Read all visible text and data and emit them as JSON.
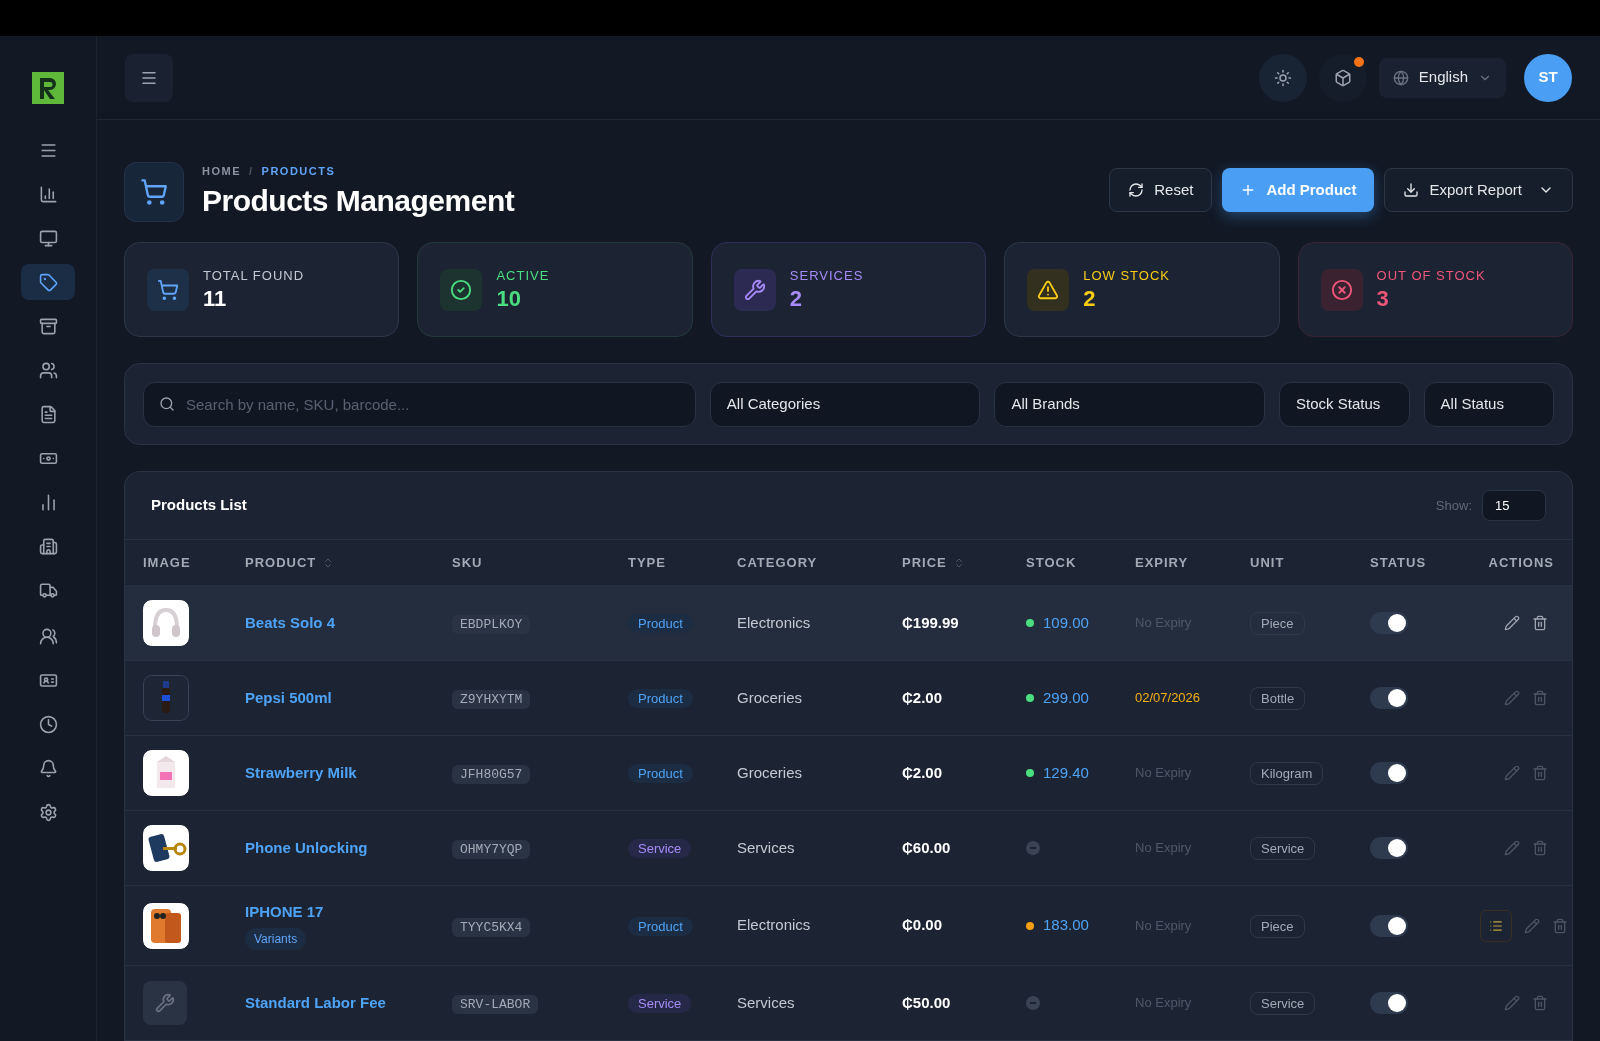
{
  "sidebar": {
    "items": [
      {
        "selected": false
      },
      {
        "selected": false
      },
      {
        "selected": false
      },
      {
        "selected": true
      },
      {
        "selected": false
      },
      {
        "selected": false
      },
      {
        "selected": false
      },
      {
        "selected": false
      },
      {
        "selected": false
      },
      {
        "selected": false
      },
      {
        "selected": false
      },
      {
        "selected": false
      },
      {
        "selected": false
      },
      {
        "selected": false
      },
      {
        "selected": false
      },
      {
        "selected": false
      }
    ]
  },
  "topbar": {
    "language": "English",
    "avatar": "ST",
    "notification": true
  },
  "breadcrumb": {
    "separator": "/",
    "items": [
      {
        "label": "HOME",
        "selected": false
      },
      {
        "label": "PRODUCTS",
        "selected": true
      }
    ]
  },
  "title": "Products Management",
  "actions": [
    {
      "kind": "reset",
      "label": "Reset"
    },
    {
      "kind": "add",
      "label": "Add Product"
    },
    {
      "kind": "export",
      "label": "Export Report"
    }
  ],
  "stats": [
    {
      "kind": "total",
      "label": "TOTAL FOUND",
      "value": "11",
      "color": "#ffffff"
    },
    {
      "kind": "active",
      "label": "ACTIVE",
      "value": "10",
      "color": "#4ade80"
    },
    {
      "kind": "services",
      "label": "SERVICES",
      "value": "2",
      "color": "#a78bfa"
    },
    {
      "kind": "low",
      "label": "LOW STOCK",
      "value": "2",
      "color": "#facc15"
    },
    {
      "kind": "out",
      "label": "OUT OF STOCK",
      "value": "3",
      "color": "#f0557a"
    }
  ],
  "filters": {
    "search_placeholder": "Search by name, SKU, barcode...",
    "selects": [
      "All Categories",
      "All Brands",
      "Stock Status",
      "All Status"
    ]
  },
  "table": {
    "title": "Products List",
    "show_label": "Show:",
    "show_value": "15",
    "columns": [
      {
        "label": "IMAGE",
        "kind": "plain"
      },
      {
        "label": "PRODUCT",
        "kind": "sortable"
      },
      {
        "label": "SKU",
        "kind": "plain"
      },
      {
        "label": "TYPE",
        "kind": "plain"
      },
      {
        "label": "CATEGORY",
        "kind": "plain"
      },
      {
        "label": "PRICE",
        "kind": "sortable"
      },
      {
        "label": "STOCK",
        "kind": "plain"
      },
      {
        "label": "EXPIRY",
        "kind": "plain"
      },
      {
        "label": "UNIT",
        "kind": "plain"
      },
      {
        "label": "STATUS",
        "kind": "plain"
      },
      {
        "label": "ACTIONS",
        "kind": "plain"
      }
    ],
    "rows": [
      {
        "selected": true,
        "name": "Beats Solo 4",
        "sku": "EBDPLKOY",
        "type": {
          "kind": "product",
          "label": "Product"
        },
        "category": "Electronics",
        "price": "₵199.99",
        "stock": {
          "kind": "tracked",
          "value": "109.00",
          "color": "#4ade80"
        },
        "expiry": {
          "kind": "none",
          "text": "No Expiry"
        },
        "unit": "Piece",
        "on": true,
        "variants_action": false
      },
      {
        "selected": false,
        "name": "Pepsi 500ml",
        "sku": "Z9YHXYTM",
        "type": {
          "kind": "product",
          "label": "Product"
        },
        "category": "Groceries",
        "price": "₵2.00",
        "stock": {
          "kind": "tracked",
          "value": "299.00",
          "color": "#4ade80"
        },
        "expiry": {
          "kind": "date",
          "text": "02/07/2026"
        },
        "unit": "Bottle",
        "on": true,
        "variants_action": false
      },
      {
        "selected": false,
        "name": "Strawberry Milk",
        "sku": "JFH80G57",
        "type": {
          "kind": "product",
          "label": "Product"
        },
        "category": "Groceries",
        "price": "₵2.00",
        "stock": {
          "kind": "tracked",
          "value": "129.40",
          "color": "#4ade80"
        },
        "expiry": {
          "kind": "none",
          "text": "No Expiry"
        },
        "unit": "Kilogram",
        "on": true,
        "variants_action": false
      },
      {
        "selected": false,
        "name": "Phone Unlocking",
        "sku": "OHMY7YQP",
        "type": {
          "kind": "service",
          "label": "Service"
        },
        "category": "Services",
        "price": "₵60.00",
        "stock": {
          "kind": "untracked"
        },
        "expiry": {
          "kind": "none",
          "text": "No Expiry"
        },
        "unit": "Service",
        "on": true,
        "variants_action": false
      },
      {
        "selected": false,
        "name": "IPHONE 17",
        "variants": "Variants",
        "sku": "TYYC5KX4",
        "type": {
          "kind": "product",
          "label": "Product"
        },
        "category": "Electronics",
        "price": "₵0.00",
        "stock": {
          "kind": "tracked",
          "value": "183.00",
          "color": "#f59e0b"
        },
        "expiry": {
          "kind": "none",
          "text": "No Expiry"
        },
        "unit": "Piece",
        "on": true,
        "variants_action": true
      },
      {
        "selected": false,
        "image": {
          "kind": "placeholder"
        },
        "name": "Standard Labor Fee",
        "sku": "SRV-LABOR",
        "type": {
          "kind": "service",
          "label": "Service"
        },
        "category": "Services",
        "price": "₵50.00",
        "stock": {
          "kind": "untracked"
        },
        "expiry": {
          "kind": "none",
          "text": "No Expiry"
        },
        "unit": "Service",
        "on": true,
        "variants_action": false
      }
    ]
  }
}
